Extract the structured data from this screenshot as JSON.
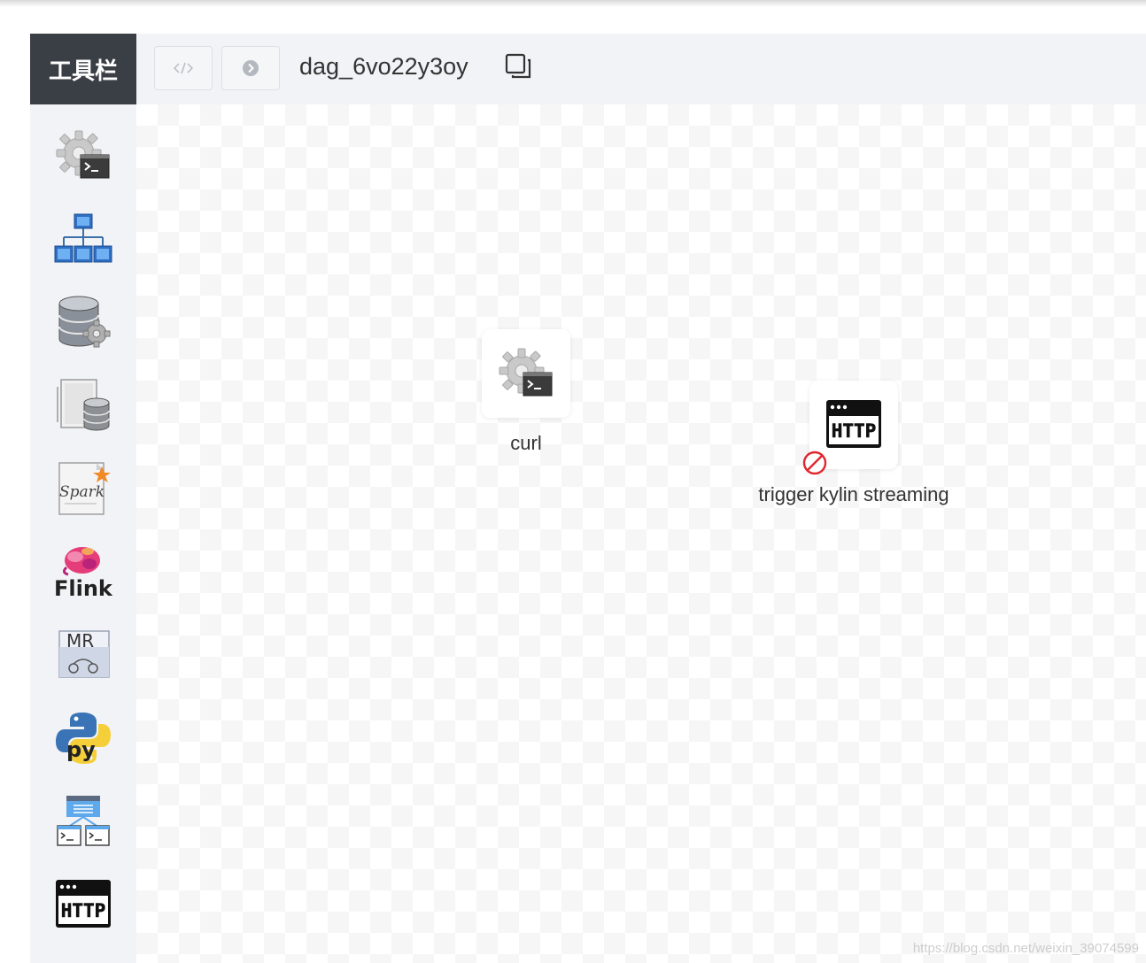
{
  "toolbar": {
    "title": "工具栏",
    "tools": [
      {
        "name": "shell",
        "icon": "gear-terminal-icon"
      },
      {
        "name": "sub_process",
        "icon": "hierarchy-icon"
      },
      {
        "name": "procedure",
        "icon": "database-gear-icon"
      },
      {
        "name": "sql",
        "icon": "document-database-icon"
      },
      {
        "name": "spark",
        "icon": "spark-icon",
        "label": "Spark"
      },
      {
        "name": "flink",
        "icon": "flink-icon",
        "label": "Flink"
      },
      {
        "name": "mr",
        "icon": "mapreduce-icon",
        "label": "MR"
      },
      {
        "name": "python",
        "icon": "python-icon",
        "label": "py"
      },
      {
        "name": "dependent",
        "icon": "dependent-icon"
      },
      {
        "name": "http",
        "icon": "http-icon",
        "label": "HTTP"
      }
    ]
  },
  "topbar": {
    "code_button_icon": "code-icon",
    "run_button_icon": "chevron-circle-icon",
    "dag_name": "dag_6vo22y3oy",
    "copy_icon": "copy-icon"
  },
  "canvas": {
    "nodes": [
      {
        "label": "curl",
        "type": "shell",
        "icon": "gear-terminal-icon",
        "status": ""
      },
      {
        "label": "trigger kylin streaming",
        "type": "http",
        "icon": "http-icon",
        "status": "forbidden",
        "status_icon": "ban-icon"
      }
    ]
  },
  "watermark": "https://blog.csdn.net/weixin_39074599",
  "colors": {
    "toolbar_header_bg": "#3a3e45",
    "panel_bg": "#f2f3f6",
    "forbidden_red": "#e0262e"
  }
}
